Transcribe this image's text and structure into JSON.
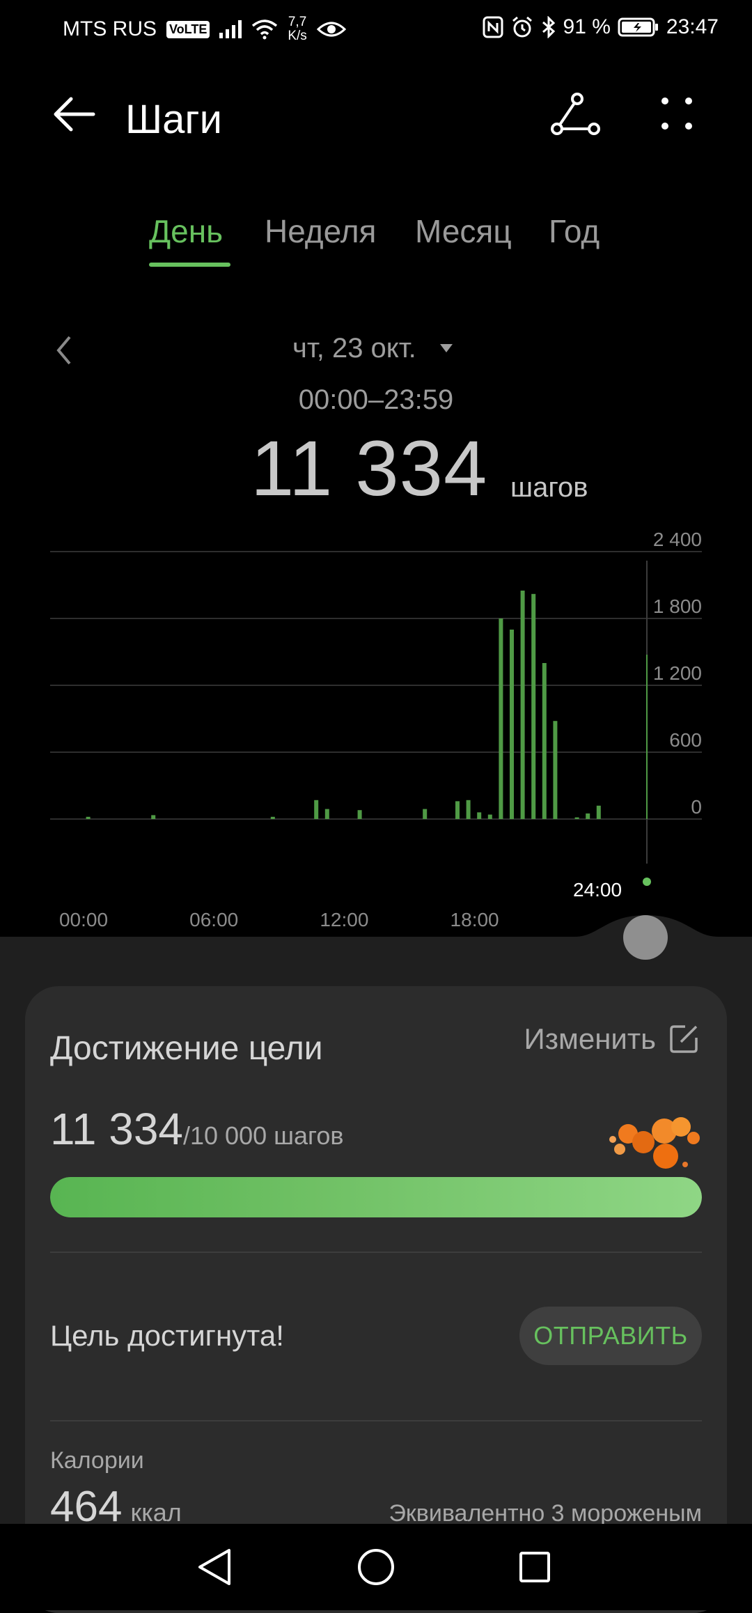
{
  "status_bar": {
    "carrier": "MTS RUS",
    "volte": "VoLTE",
    "net_speed_value": "7,7",
    "net_speed_unit": "K/s",
    "battery": "91 %",
    "time": "23:47"
  },
  "header": {
    "title": "Шаги"
  },
  "tabs": [
    {
      "label": "День",
      "active": true
    },
    {
      "label": "Неделя",
      "active": false
    },
    {
      "label": "Месяц",
      "active": false
    },
    {
      "label": "Год",
      "active": false
    }
  ],
  "date": {
    "label": "чт, 23 окт.",
    "time_range": "00:00–23:59"
  },
  "summary": {
    "steps": "11 334",
    "unit": "шагов"
  },
  "chart_data": {
    "type": "bar",
    "ylim": [
      0,
      2400
    ],
    "y_ticks": [
      "2 400",
      "1 800",
      "1 200",
      "600",
      "0"
    ],
    "x_ticks": [
      "00:00",
      "06:00",
      "12:00",
      "18:00"
    ],
    "cursor_label": "24:00",
    "bar_color": "#4f9a45",
    "bars": [
      {
        "hour": 3.5,
        "value": 20
      },
      {
        "hour": 9.5,
        "value": 35
      },
      {
        "hour": 20.5,
        "value": 20
      },
      {
        "hour": 24.5,
        "value": 170
      },
      {
        "hour": 25.5,
        "value": 90
      },
      {
        "hour": 28.5,
        "value": 80
      },
      {
        "hour": 34.5,
        "value": 90
      },
      {
        "hour": 37.5,
        "value": 160
      },
      {
        "hour": 38.5,
        "value": 170
      },
      {
        "hour": 39.5,
        "value": 60
      },
      {
        "hour": 40.5,
        "value": 40
      },
      {
        "hour": 41.5,
        "value": 1800
      },
      {
        "hour": 42.5,
        "value": 1700
      },
      {
        "hour": 43.5,
        "value": 2050
      },
      {
        "hour": 44.5,
        "value": 2020
      },
      {
        "hour": 45.5,
        "value": 1400
      },
      {
        "hour": 46.5,
        "value": 880
      },
      {
        "hour": 48.5,
        "value": 15
      },
      {
        "hour": 49.5,
        "value": 50
      },
      {
        "hour": 50.5,
        "value": 120
      }
    ]
  },
  "goal": {
    "title": "Достижение цели",
    "edit_label": "Изменить",
    "current": "11 334",
    "target": "/10 000 шагов",
    "progress_fraction": 1.0,
    "achieved_text": "Цель достигнута!",
    "share_label": "ОТПРАВИТЬ"
  },
  "calories": {
    "label": "Калории",
    "value": "464",
    "unit": "ккал",
    "equivalent": "Эквивалентно 3 мороженым"
  },
  "icons": {
    "back": "arrow-left-icon",
    "route": "route-icon",
    "more": "more-dots-icon"
  },
  "colors": {
    "accent": "#67c15e",
    "card": "#2c2c2c"
  }
}
